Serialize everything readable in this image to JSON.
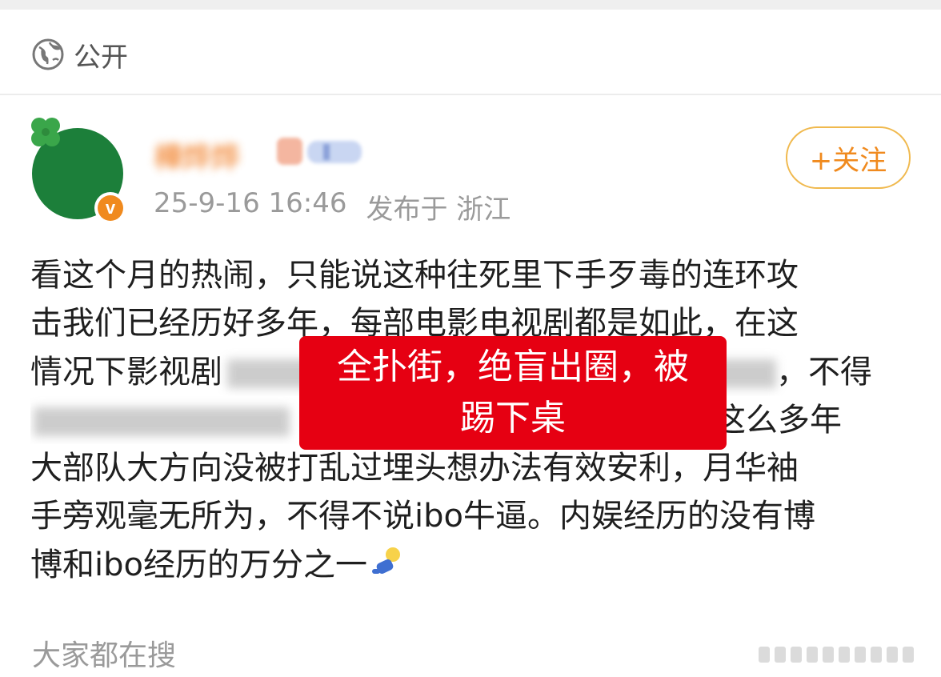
{
  "visibility": {
    "label": "公开"
  },
  "author": {
    "name": "樺烨烨"
  },
  "post": {
    "date": "25-9-16 16:46",
    "location": "发布于 浙江",
    "lines": [
      "看这个月的热闹，只能说这种往死里下手歹毒的连环攻",
      "击我们已经历好多年，每部电影电视剧都是如此，在这",
      "情况下影视剧",
      "，不得",
      "这么多年",
      "大部队大方向没被打乱过埋头想办法有效安利，月华袖",
      "手旁观毫无所为，不得不说ibo牛逼。内娱经历的没有博",
      "博和ibo经历的万分之一"
    ]
  },
  "follow_button": {
    "label": "+关注"
  },
  "overlay": {
    "line1": "全扑街，绝盲出圈，被",
    "line2": "踢下桌"
  },
  "search_section": {
    "title": "大家都在搜"
  },
  "colors": {
    "accent_orange": "#f08a1e",
    "follow_border": "#f0b94e",
    "overlay_red": "#e60012",
    "avatar_green": "#1c7f3a"
  },
  "icons": [
    "globe-icon",
    "clover-icon",
    "verified-badge-icon",
    "doll-emoji-icon"
  ]
}
